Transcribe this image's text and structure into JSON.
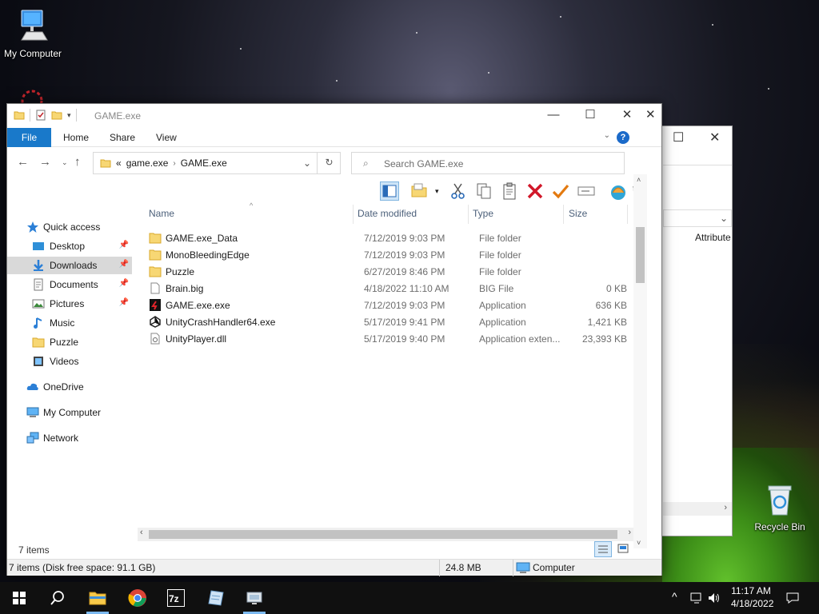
{
  "desktop": {
    "icons": [
      {
        "label": "My Computer"
      },
      {
        "label": "Recycle Bin"
      }
    ]
  },
  "window": {
    "title": "GAME.exe",
    "ribbon_tabs": [
      "File",
      "Home",
      "Share",
      "View"
    ],
    "help_label": "?",
    "address": {
      "overflow": "«",
      "crumbs": [
        "game.exe",
        "GAME.exe"
      ]
    },
    "search": {
      "placeholder": "Search GAME.exe"
    },
    "nav_pane": {
      "quick_access": "Quick access",
      "pinned": [
        "Desktop",
        "Downloads",
        "Documents",
        "Pictures"
      ],
      "unpinned": [
        "Music",
        "Puzzle",
        "Videos"
      ],
      "onedrive": "OneDrive",
      "my_computer": "My Computer",
      "network": "Network"
    },
    "columns": {
      "name": "Name",
      "date": "Date modified",
      "type": "Type",
      "size": "Size"
    },
    "files": [
      {
        "name": "GAME.exe_Data",
        "date": "7/12/2019 9:03 PM",
        "type": "File folder",
        "size": "",
        "icon": "folder-icon"
      },
      {
        "name": "MonoBleedingEdge",
        "date": "7/12/2019 9:03 PM",
        "type": "File folder",
        "size": "",
        "icon": "folder-icon"
      },
      {
        "name": "Puzzle",
        "date": "6/27/2019 8:46 PM",
        "type": "File folder",
        "size": "",
        "icon": "folder-icon"
      },
      {
        "name": "Brain.big",
        "date": "4/18/2022 11:10 AM",
        "type": "BIG File",
        "size": "0 KB",
        "icon": "file-icon"
      },
      {
        "name": "GAME.exe.exe",
        "date": "7/12/2019 9:03 PM",
        "type": "Application",
        "size": "636 KB",
        "icon": "game-app-icon"
      },
      {
        "name": "UnityCrashHandler64.exe",
        "date": "5/17/2019 9:41 PM",
        "type": "Application",
        "size": "1,421 KB",
        "icon": "unity-icon"
      },
      {
        "name": "UnityPlayer.dll",
        "date": "5/17/2019 9:40 PM",
        "type": "Application exten...",
        "size": "23,393 KB",
        "icon": "dll-icon"
      }
    ],
    "status": {
      "items_count": "7 items",
      "detail": "7 items (Disk free space: 91.1 GB)",
      "size": "24.8 MB",
      "location": "Computer"
    }
  },
  "background_window": {
    "column_header": "Attribute",
    "button_fragment": "k"
  },
  "taskbar": {
    "time": "11:17 AM",
    "date": "4/18/2022"
  }
}
